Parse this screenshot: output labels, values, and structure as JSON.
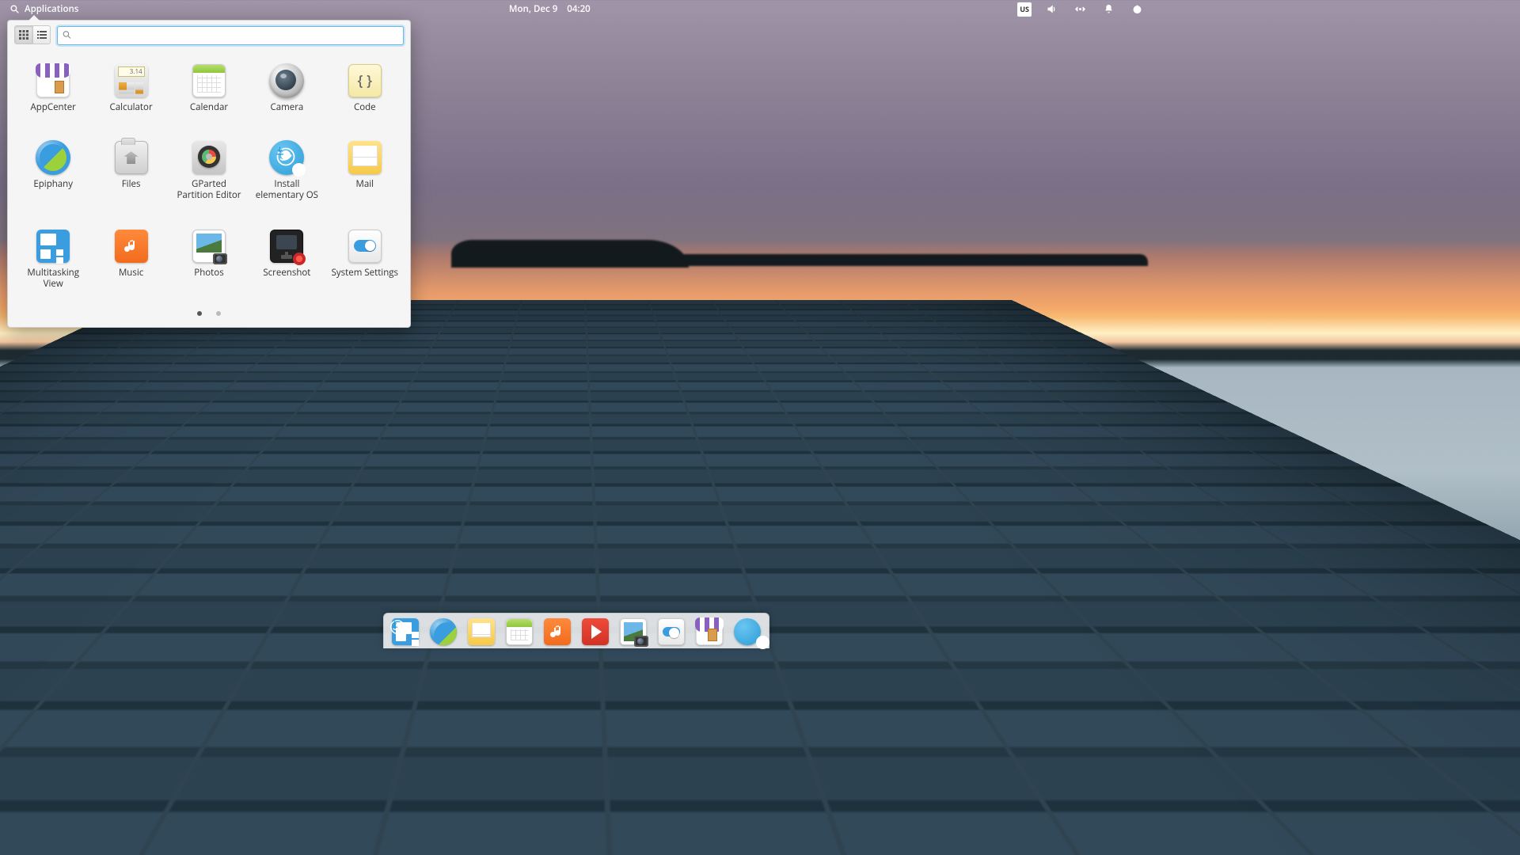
{
  "panel": {
    "applications_label": "Applications",
    "date": "Mon, Dec  9",
    "time": "04:20",
    "keyboard_indicator": "US"
  },
  "app_menu": {
    "search_placeholder": "",
    "apps": [
      {
        "id": "appcenter",
        "label": "AppCenter"
      },
      {
        "id": "calculator",
        "label": "Calculator"
      },
      {
        "id": "calendar",
        "label": "Calendar"
      },
      {
        "id": "camera",
        "label": "Camera"
      },
      {
        "id": "code",
        "label": "Code"
      },
      {
        "id": "epiphany",
        "label": "Epiphany"
      },
      {
        "id": "files",
        "label": "Files"
      },
      {
        "id": "gparted",
        "label": "GParted Partition Editor"
      },
      {
        "id": "install",
        "label": "Install elementary OS"
      },
      {
        "id": "mail",
        "label": "Mail"
      },
      {
        "id": "multitask",
        "label": "Multitasking View"
      },
      {
        "id": "music",
        "label": "Music"
      },
      {
        "id": "photos",
        "label": "Photos"
      },
      {
        "id": "screenshot",
        "label": "Screenshot"
      },
      {
        "id": "settings",
        "label": "System Settings"
      }
    ],
    "code_glyph": "{ }",
    "pages": {
      "total": 2,
      "active": 1
    }
  },
  "dock": {
    "items": [
      {
        "id": "multitask",
        "name": "Multitasking View"
      },
      {
        "id": "epiphany",
        "name": "Epiphany"
      },
      {
        "id": "mail",
        "name": "Mail"
      },
      {
        "id": "calendar",
        "name": "Calendar"
      },
      {
        "id": "music",
        "name": "Music"
      },
      {
        "id": "video",
        "name": "Videos"
      },
      {
        "id": "photos",
        "name": "Photos"
      },
      {
        "id": "settings",
        "name": "System Settings"
      },
      {
        "id": "appcenter",
        "name": "AppCenter"
      },
      {
        "id": "install",
        "name": "Install elementary OS"
      }
    ]
  }
}
